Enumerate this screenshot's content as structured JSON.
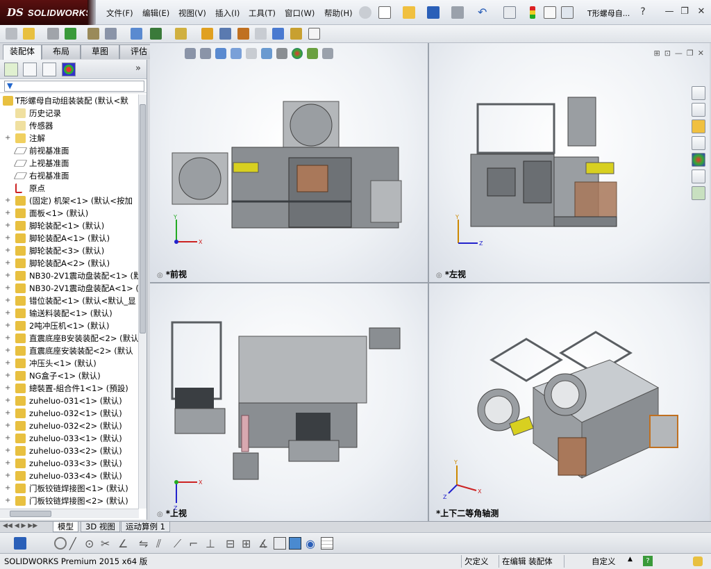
{
  "app": {
    "logo_ds": "DS",
    "logo_text": "SOLIDWORKS",
    "doc_title": "T形螺母自...",
    "help": "?"
  },
  "menu": [
    "文件(F)",
    "编辑(E)",
    "视图(V)",
    "插入(I)",
    "工具(T)",
    "窗口(W)",
    "帮助(H)"
  ],
  "window_controls": {
    "minimize": "—",
    "restore": "❐",
    "close": "✕"
  },
  "tabs": [
    "装配体",
    "布局",
    "草图",
    "评估"
  ],
  "tree": {
    "root": "T形螺母自动组装装配  (默认<默",
    "items": [
      {
        "label": "历史记录",
        "icon": "history-icon",
        "exp": false
      },
      {
        "label": "传感器",
        "icon": "sensor-icon",
        "exp": false
      },
      {
        "label": "注解",
        "icon": "annotation-icon",
        "exp": true
      },
      {
        "label": "前视基准面",
        "icon": "plane-icon",
        "exp": false
      },
      {
        "label": "上视基准面",
        "icon": "plane-icon",
        "exp": false
      },
      {
        "label": "右视基准面",
        "icon": "plane-icon",
        "exp": false
      },
      {
        "label": "原点",
        "icon": "origin-icon",
        "exp": false
      },
      {
        "label": "(固定) 机架<1> (默认<按加",
        "icon": "subassembly-icon",
        "exp": true
      },
      {
        "label": "面板<1> (默认)",
        "icon": "subassembly-icon",
        "exp": true
      },
      {
        "label": "脚轮装配<1> (默认)",
        "icon": "subassembly-icon",
        "exp": true
      },
      {
        "label": "脚轮装配A<1> (默认)",
        "icon": "subassembly-icon",
        "exp": true
      },
      {
        "label": "脚轮装配<3> (默认)",
        "icon": "subassembly-icon",
        "exp": true
      },
      {
        "label": "脚轮装配A<2> (默认)",
        "icon": "subassembly-icon",
        "exp": true
      },
      {
        "label": "NB30-2V1震动盘装配<1> (默认",
        "icon": "subassembly-icon",
        "exp": true
      },
      {
        "label": "NB30-2V1震动盘装配A<1> (默",
        "icon": "subassembly-icon",
        "exp": true
      },
      {
        "label": "错位装配<1> (默认<默认_显",
        "icon": "subassembly-icon",
        "exp": true
      },
      {
        "label": "输送料装配<1> (默认)",
        "icon": "subassembly-icon",
        "exp": true
      },
      {
        "label": "2吨冲压机<1> (默认)",
        "icon": "subassembly-icon",
        "exp": true
      },
      {
        "label": "直震底座B安装装配<2> (默认",
        "icon": "subassembly-icon",
        "exp": true
      },
      {
        "label": "直震底座安装装配<2> (默认",
        "icon": "subassembly-icon",
        "exp": true
      },
      {
        "label": "冲压头<1> (默认)",
        "icon": "subassembly-icon",
        "exp": true
      },
      {
        "label": "NG盒子<1> (默认)",
        "icon": "subassembly-icon",
        "exp": true
      },
      {
        "label": "總裝置-組合件1<1> (預設)",
        "icon": "subassembly-icon",
        "exp": true
      },
      {
        "label": "zuheluo-031<1> (默认)",
        "icon": "subassembly-icon",
        "exp": true
      },
      {
        "label": "zuheluo-032<1> (默认)",
        "icon": "subassembly-icon",
        "exp": true
      },
      {
        "label": "zuheluo-032<2> (默认)",
        "icon": "subassembly-icon",
        "exp": true
      },
      {
        "label": "zuheluo-033<1> (默认)",
        "icon": "subassembly-icon",
        "exp": true
      },
      {
        "label": "zuheluo-033<2> (默认)",
        "icon": "subassembly-icon",
        "exp": true
      },
      {
        "label": "zuheluo-033<3> (默认)",
        "icon": "subassembly-icon",
        "exp": true
      },
      {
        "label": "zuheluo-033<4> (默认)",
        "icon": "subassembly-icon",
        "exp": true
      },
      {
        "label": "门板铰链焊接图<1> (默认)",
        "icon": "subassembly-icon",
        "exp": true
      },
      {
        "label": "门板铰链焊接图<2> (默认)",
        "icon": "subassembly-icon",
        "exp": true
      }
    ]
  },
  "viewports": {
    "front": "*前视",
    "left": "*左视",
    "top": "*上视",
    "iso": "*上下二等角轴测"
  },
  "axes": {
    "x": "X",
    "y": "Y",
    "z": "Z"
  },
  "bottom_tabs": [
    "模型",
    "3D 视图",
    "运动算例 1"
  ],
  "status": {
    "product": "SOLIDWORKS Premium 2015 x64 版",
    "underdefined": "欠定义",
    "editing": "在编辑 装配体",
    "custom": "自定义"
  },
  "colors": {
    "accent": "#2a5fb8",
    "machine_gray": "#8a8e92",
    "bronze": "#a9785a",
    "yellow": "#d8d020",
    "frame": "#5a5e62"
  }
}
